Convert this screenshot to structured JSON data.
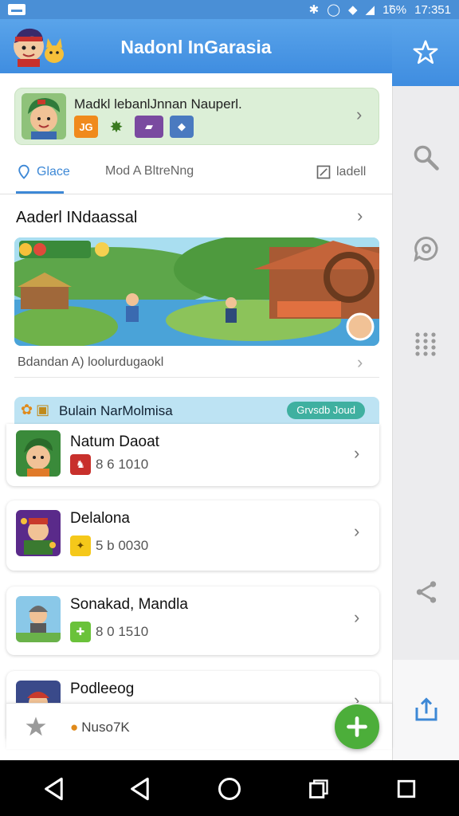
{
  "status_bar": {
    "battery": "1̃6%",
    "time": "17:351"
  },
  "header": {
    "title": "Nadonl InGarasia"
  },
  "promo": {
    "text": "Madkl lebanlJnnan Nauperl."
  },
  "tabs": [
    {
      "label": "Glace",
      "icon": "location-pin-icon"
    },
    {
      "label": "Mod A BltreNng",
      "icon": ""
    },
    {
      "label": "ladell",
      "icon": "edit-icon"
    }
  ],
  "featured": {
    "title": "Aaderl INdaassal",
    "caption": "Bdandan  A) loolurdugaokl"
  },
  "list_section": {
    "title": "Bulain NarMolmisa",
    "pill": "Grvsdb Joud"
  },
  "games": [
    {
      "name": "Natum Daoat",
      "stat": "8 6 1010"
    },
    {
      "name": "Delalona",
      "stat": "5 b 0030"
    },
    {
      "name": "Sonakad, Mandla",
      "stat": "8 0 1510"
    },
    {
      "name": "Podleeog",
      "stat": ""
    }
  ],
  "bottom_bar": {
    "text": "Nuso7K"
  },
  "colors": {
    "header_blue": "#4a8fd6",
    "accent_blue": "#3d88d6",
    "fab_green": "#4cae3a"
  }
}
